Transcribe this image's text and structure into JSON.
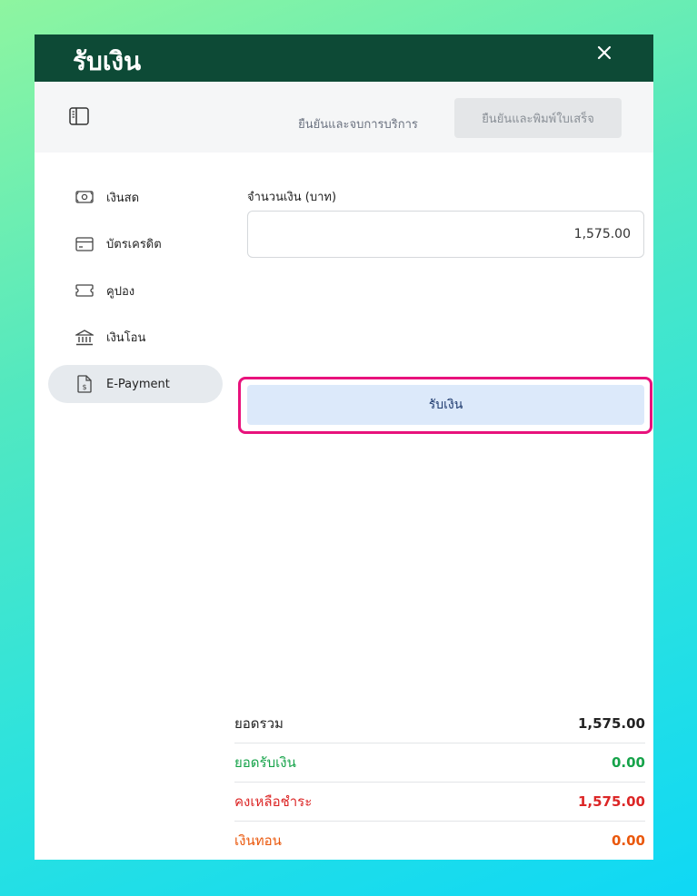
{
  "window": {
    "title": "รับเงิน"
  },
  "toolbar": {
    "confirm_end_service": "ยืนยันและจบการบริการ",
    "confirm_print_receipt": "ยืนยันและพิมพ์ใบเสร็จ"
  },
  "sidebar": {
    "items": [
      {
        "label": "เงินสด",
        "icon": "cash-icon"
      },
      {
        "label": "บัตรเครดิต",
        "icon": "credit-card-icon"
      },
      {
        "label": "คูปอง",
        "icon": "coupon-icon"
      },
      {
        "label": "เงินโอน",
        "icon": "bank-icon"
      },
      {
        "label": "E-Payment",
        "icon": "e-payment-icon",
        "active": true
      }
    ]
  },
  "form": {
    "amount_label": "จำนวนเงิน (บาท)",
    "amount_value": "1,575.00",
    "receive_button": "รับเงิน"
  },
  "summary": {
    "rows": [
      {
        "label": "ยอดรวม",
        "value": "1,575.00",
        "color": "#222222"
      },
      {
        "label": "ยอดรับเงิน",
        "value": "0.00",
        "color": "#16a34a"
      },
      {
        "label": "คงเหลือชำระ",
        "value": "1,575.00",
        "color": "#dc2626"
      },
      {
        "label": "เงินทอน",
        "value": "0.00",
        "color": "#ea580c"
      }
    ]
  },
  "colors": {
    "header_bg": "#0d4a36",
    "highlight": "#e8127c",
    "primary_button_bg": "#dce9fa"
  }
}
